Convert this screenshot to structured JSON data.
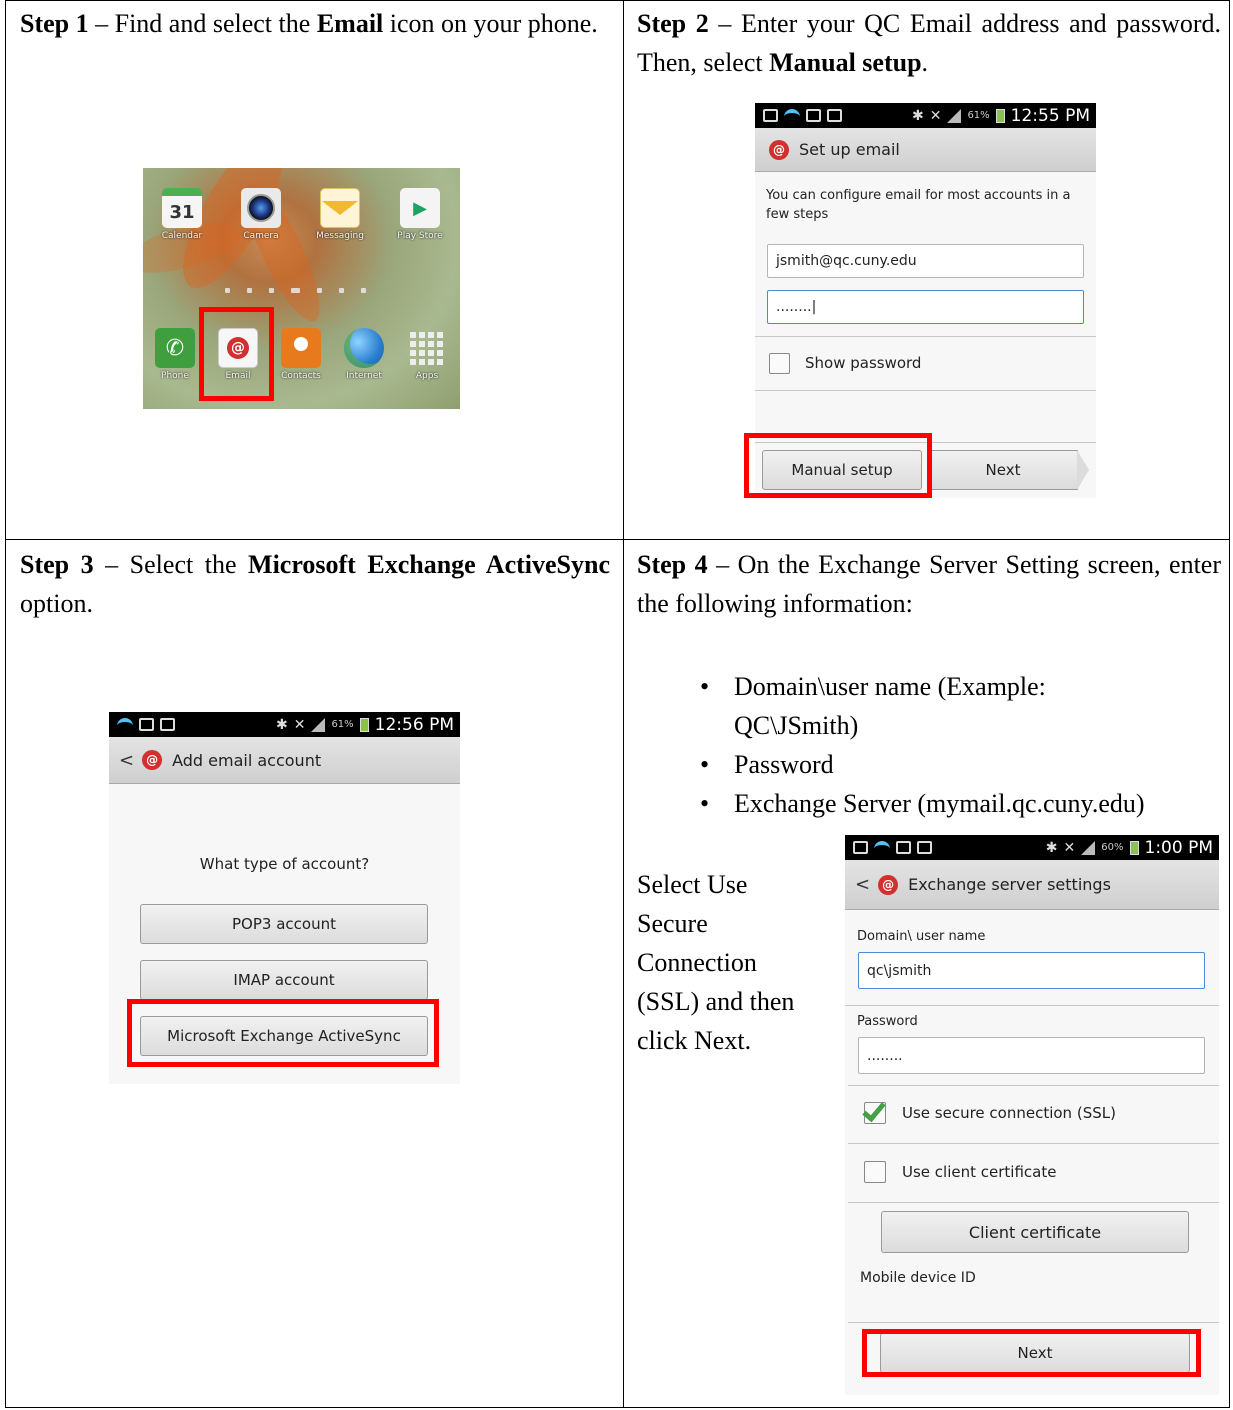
{
  "step1": {
    "label": "Step 1",
    "dash": " – Find and select the ",
    "bold": "Email",
    "rest": " icon on your phone.",
    "homescreen": {
      "apps_top": [
        {
          "label": "Calendar",
          "icon": "calendar-icon",
          "glyph": "31"
        },
        {
          "label": "Camera",
          "icon": "camera-icon",
          "glyph": ""
        },
        {
          "label": "Messaging",
          "icon": "envelope-icon",
          "glyph": ""
        },
        {
          "label": "Play Store",
          "icon": "play-store-icon",
          "glyph": "▶"
        }
      ],
      "apps_bottom": [
        {
          "label": "Phone",
          "icon": "phone-icon",
          "glyph": "✆"
        },
        {
          "label": "Email",
          "icon": "email-icon",
          "glyph": "@"
        },
        {
          "label": "Contacts",
          "icon": "contacts-icon",
          "glyph": "👤"
        },
        {
          "label": "Internet",
          "icon": "globe-icon",
          "glyph": ""
        },
        {
          "label": "Apps",
          "icon": "apps-grid-icon",
          "glyph": ""
        }
      ]
    }
  },
  "step2": {
    "label": "Step 2",
    "dash": " – Enter your QC Email address and password. Then, select ",
    "bold": "Manual setup",
    "end": ".",
    "phone": {
      "time": "12:55 PM",
      "battery": "61%",
      "title": "Set up email",
      "intro": "You can configure email for most accounts in a few steps",
      "email_value": "jsmith@qc.cuny.edu",
      "password_value": "........|",
      "show_password": "Show password",
      "manual_setup": "Manual setup",
      "next": "Next"
    }
  },
  "step3": {
    "label": "Step 3",
    "dash": " – Select the ",
    "bold": "Microsoft Exchange ActiveSync",
    "rest": " option.",
    "phone": {
      "time": "12:56 PM",
      "battery": "61%",
      "title": "Add email account",
      "question": "What type of account?",
      "options": [
        "POP3 account",
        "IMAP account",
        "Microsoft Exchange ActiveSync"
      ]
    }
  },
  "step4": {
    "label": "Step 4",
    "dash": " – On the Exchange Server Setting screen, enter the following information:",
    "bullets": [
      "Domain\\user name (Example: QC\\JSmith)",
      "Password",
      "Exchange Server (mymail.qc.cuny.edu)"
    ],
    "side_note": "Select Use Secure Connection (SSL) and then click Next.",
    "phone": {
      "time": "1:00 PM",
      "battery": "60%",
      "title": "Exchange server settings",
      "domain_label": "Domain\\ user name",
      "domain_value": "qc\\jsmith",
      "password_label": "Password",
      "password_value": "........",
      "ssl_label": "Use secure connection (SSL)",
      "ssl_checked": true,
      "client_cert_checkbox": "Use client certificate",
      "client_cert_button": "Client certificate",
      "device_id_label": "Mobile device ID",
      "next": "Next"
    }
  },
  "colors": {
    "highlight": "#ff0000",
    "email_red": "#d32f2f",
    "ssl_check": "#43a047"
  }
}
